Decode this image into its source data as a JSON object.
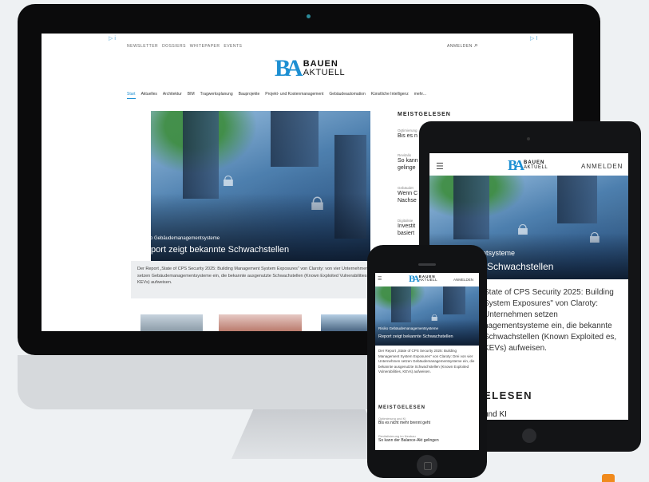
{
  "site": {
    "logo_mark": "BA",
    "logo_top": "BAUEN",
    "logo_bottom": "AKTUELL"
  },
  "desktop": {
    "ad_marker_left": "▷ i",
    "ad_marker_right": "▷ I",
    "utility_nav": [
      "NEWSLETTER",
      "DOSSIERS",
      "WHITEPAPER",
      "EVENTS"
    ],
    "login": "ANMELDEN",
    "main_nav": [
      {
        "label": "Start",
        "active": true
      },
      {
        "label": "Aktuelles"
      },
      {
        "label": "Architektur"
      },
      {
        "label": "BIM"
      },
      {
        "label": "Tragwerksplanung"
      },
      {
        "label": "Bauprojekte"
      },
      {
        "label": "Projekt- und Kostenmanagement"
      },
      {
        "label": "Gebäudeautomation"
      },
      {
        "label": "Künstliche Intelligenz"
      },
      {
        "label": "mehr..."
      }
    ],
    "hero": {
      "kicker": "Risiko Gebäudemanagementsysteme",
      "headline": "Report zeigt bekannte Schwachstellen",
      "teaser": "Der Report „State of CPS Security 2025: Building Management System Exposures\" von Claroty: von vier Unternehmen setzen Gebäudemanagementsysteme ein, die bekannte ausgenutzte Schwachstellen (Known Exploited Vulnerabilities, KEVs) aufweisen."
    },
    "meistgelesen": {
      "title": "MEISTGELESEN",
      "items": [
        {
          "category": "Optimierung",
          "lines": [
            "Bis es n"
          ]
        },
        {
          "category": "Revitalis",
          "lines": [
            "So kann",
            "gelinge"
          ]
        },
        {
          "category": "Gebäudet",
          "lines": [
            "Wenn C",
            "Nachse"
          ]
        },
        {
          "category": "Digitalisie",
          "lines": [
            "Investit",
            "basiert"
          ]
        }
      ]
    }
  },
  "tablet": {
    "login": "ANMELDEN",
    "kicker": "udemanagementsysteme",
    "headline": "gt bekannte Schwachstellen",
    "teaser": "State of CPS Security 2025: Building System Exposures\" von Claroty: Unternehmen setzen nagementsysteme ein, die bekannte Schwachstellen (Known Exploited es, KEVs) aufweisen.",
    "meistgelesen_title": "ELESEN",
    "meistgelesen_item": "und KI"
  },
  "phone": {
    "login": "ANMELDEN",
    "kicker": "Risiko Gebäudemanagementsysteme",
    "headline": "Report zeigt bekannte Schwachstellen",
    "teaser": "Der Report „State of CPS Security 2025: Building Management System Exposures\" von Claroty: Drei von vier Unternehmen setzen Gebäudemanagementsysteme ein, die bekannte ausgenutzte Schwachstellen (Known Exploited Vulnerabilities, KEVs) aufweisen.",
    "meistgelesen": {
      "title": "MEISTGELESEN",
      "items": [
        {
          "category": "Optimierung und KI",
          "line": "Bis es nicht mehr brennt geht"
        },
        {
          "category": "Revitalisierung im Neubau",
          "line": "So kann der Balance-Akt gelingen"
        }
      ]
    }
  },
  "colors": {
    "accent": "#1d8fd2",
    "background": "#eef1f3",
    "device_frame": "#111214"
  }
}
